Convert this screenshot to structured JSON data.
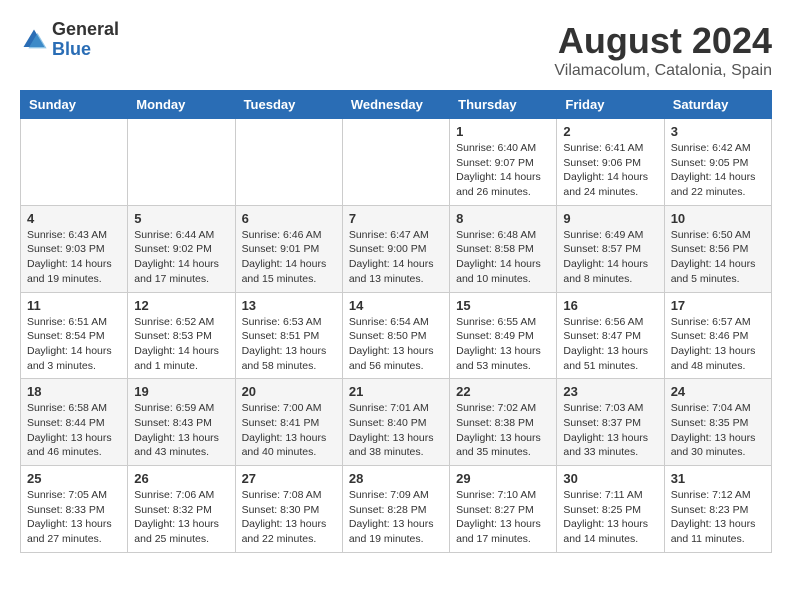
{
  "logo": {
    "general": "General",
    "blue": "Blue"
  },
  "title": "August 2024",
  "subtitle": "Vilamacolum, Catalonia, Spain",
  "headers": [
    "Sunday",
    "Monday",
    "Tuesday",
    "Wednesday",
    "Thursday",
    "Friday",
    "Saturday"
  ],
  "weeks": [
    [
      {
        "day": "",
        "info": ""
      },
      {
        "day": "",
        "info": ""
      },
      {
        "day": "",
        "info": ""
      },
      {
        "day": "",
        "info": ""
      },
      {
        "day": "1",
        "info": "Sunrise: 6:40 AM\nSunset: 9:07 PM\nDaylight: 14 hours and 26 minutes."
      },
      {
        "day": "2",
        "info": "Sunrise: 6:41 AM\nSunset: 9:06 PM\nDaylight: 14 hours and 24 minutes."
      },
      {
        "day": "3",
        "info": "Sunrise: 6:42 AM\nSunset: 9:05 PM\nDaylight: 14 hours and 22 minutes."
      }
    ],
    [
      {
        "day": "4",
        "info": "Sunrise: 6:43 AM\nSunset: 9:03 PM\nDaylight: 14 hours and 19 minutes."
      },
      {
        "day": "5",
        "info": "Sunrise: 6:44 AM\nSunset: 9:02 PM\nDaylight: 14 hours and 17 minutes."
      },
      {
        "day": "6",
        "info": "Sunrise: 6:46 AM\nSunset: 9:01 PM\nDaylight: 14 hours and 15 minutes."
      },
      {
        "day": "7",
        "info": "Sunrise: 6:47 AM\nSunset: 9:00 PM\nDaylight: 14 hours and 13 minutes."
      },
      {
        "day": "8",
        "info": "Sunrise: 6:48 AM\nSunset: 8:58 PM\nDaylight: 14 hours and 10 minutes."
      },
      {
        "day": "9",
        "info": "Sunrise: 6:49 AM\nSunset: 8:57 PM\nDaylight: 14 hours and 8 minutes."
      },
      {
        "day": "10",
        "info": "Sunrise: 6:50 AM\nSunset: 8:56 PM\nDaylight: 14 hours and 5 minutes."
      }
    ],
    [
      {
        "day": "11",
        "info": "Sunrise: 6:51 AM\nSunset: 8:54 PM\nDaylight: 14 hours and 3 minutes."
      },
      {
        "day": "12",
        "info": "Sunrise: 6:52 AM\nSunset: 8:53 PM\nDaylight: 14 hours and 1 minute."
      },
      {
        "day": "13",
        "info": "Sunrise: 6:53 AM\nSunset: 8:51 PM\nDaylight: 13 hours and 58 minutes."
      },
      {
        "day": "14",
        "info": "Sunrise: 6:54 AM\nSunset: 8:50 PM\nDaylight: 13 hours and 56 minutes."
      },
      {
        "day": "15",
        "info": "Sunrise: 6:55 AM\nSunset: 8:49 PM\nDaylight: 13 hours and 53 minutes."
      },
      {
        "day": "16",
        "info": "Sunrise: 6:56 AM\nSunset: 8:47 PM\nDaylight: 13 hours and 51 minutes."
      },
      {
        "day": "17",
        "info": "Sunrise: 6:57 AM\nSunset: 8:46 PM\nDaylight: 13 hours and 48 minutes."
      }
    ],
    [
      {
        "day": "18",
        "info": "Sunrise: 6:58 AM\nSunset: 8:44 PM\nDaylight: 13 hours and 46 minutes."
      },
      {
        "day": "19",
        "info": "Sunrise: 6:59 AM\nSunset: 8:43 PM\nDaylight: 13 hours and 43 minutes."
      },
      {
        "day": "20",
        "info": "Sunrise: 7:00 AM\nSunset: 8:41 PM\nDaylight: 13 hours and 40 minutes."
      },
      {
        "day": "21",
        "info": "Sunrise: 7:01 AM\nSunset: 8:40 PM\nDaylight: 13 hours and 38 minutes."
      },
      {
        "day": "22",
        "info": "Sunrise: 7:02 AM\nSunset: 8:38 PM\nDaylight: 13 hours and 35 minutes."
      },
      {
        "day": "23",
        "info": "Sunrise: 7:03 AM\nSunset: 8:37 PM\nDaylight: 13 hours and 33 minutes."
      },
      {
        "day": "24",
        "info": "Sunrise: 7:04 AM\nSunset: 8:35 PM\nDaylight: 13 hours and 30 minutes."
      }
    ],
    [
      {
        "day": "25",
        "info": "Sunrise: 7:05 AM\nSunset: 8:33 PM\nDaylight: 13 hours and 27 minutes."
      },
      {
        "day": "26",
        "info": "Sunrise: 7:06 AM\nSunset: 8:32 PM\nDaylight: 13 hours and 25 minutes."
      },
      {
        "day": "27",
        "info": "Sunrise: 7:08 AM\nSunset: 8:30 PM\nDaylight: 13 hours and 22 minutes."
      },
      {
        "day": "28",
        "info": "Sunrise: 7:09 AM\nSunset: 8:28 PM\nDaylight: 13 hours and 19 minutes."
      },
      {
        "day": "29",
        "info": "Sunrise: 7:10 AM\nSunset: 8:27 PM\nDaylight: 13 hours and 17 minutes."
      },
      {
        "day": "30",
        "info": "Sunrise: 7:11 AM\nSunset: 8:25 PM\nDaylight: 13 hours and 14 minutes."
      },
      {
        "day": "31",
        "info": "Sunrise: 7:12 AM\nSunset: 8:23 PM\nDaylight: 13 hours and 11 minutes."
      }
    ]
  ]
}
